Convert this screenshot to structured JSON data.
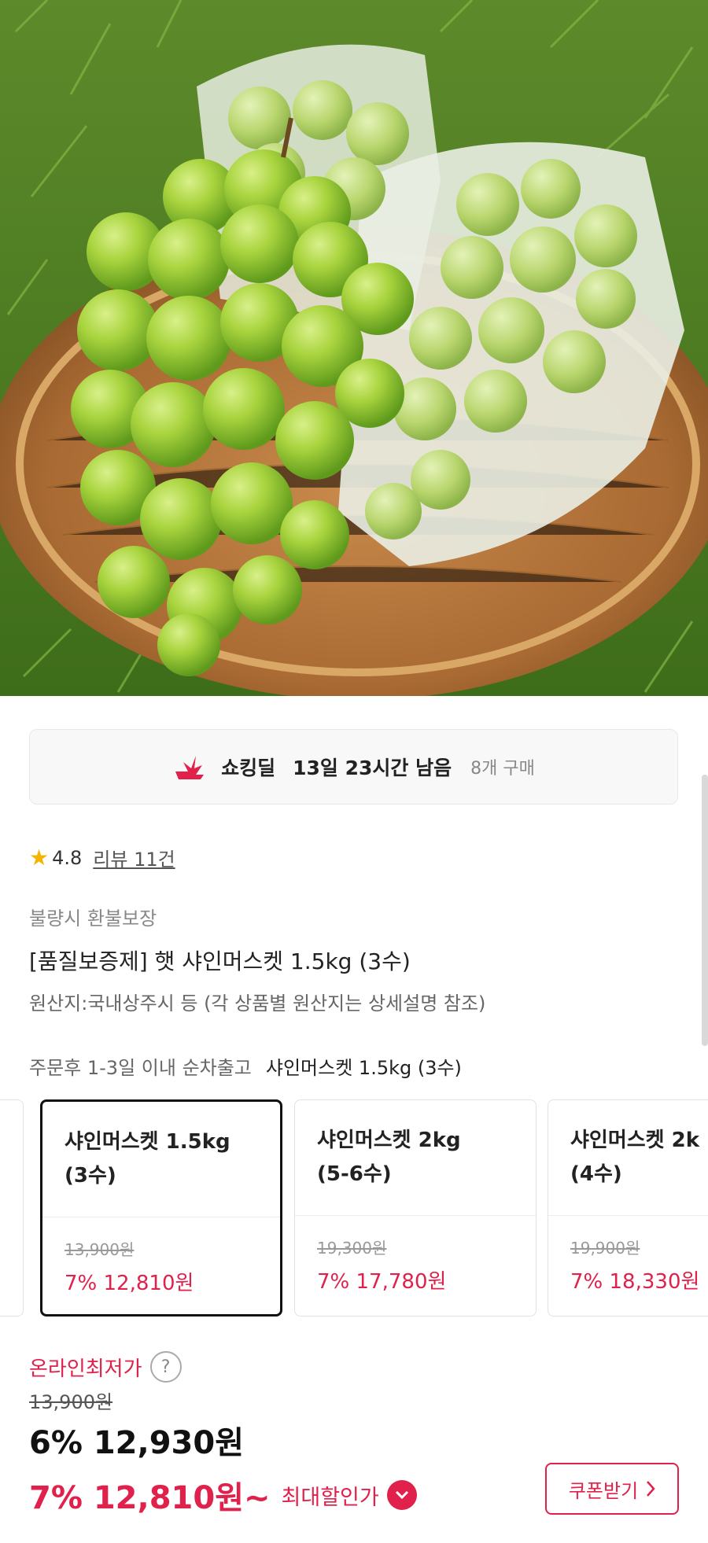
{
  "hero": {
    "image_name": "shine-muscat-grapes-in-basket"
  },
  "deal": {
    "name": "쇼킹딜",
    "time_left": "13일 23시간 남음",
    "purchase_count": "8개 구매",
    "logo_color": "#e0214b"
  },
  "rating": {
    "score": "4.8",
    "reviews": "리뷰 11건"
  },
  "refund": "불량시 환불보장",
  "product_title": "[품질보증제] 햇 샤인머스켓 1.5kg (3수)",
  "origin": "원산지:국내상주시 등 (각 상품별 원산지는 상세설명 참조)",
  "shipping": {
    "text": "주문후 1-3일 이내 순차출고",
    "selected_option": "샤인머스켓 1.5kg (3수)"
  },
  "options": [
    {
      "name_line1": "샤인머스켓 1.5kg",
      "name_line2": "(3수)",
      "original": "13,900원",
      "price": "7% 12,810원",
      "selected": true
    },
    {
      "name_line1": "샤인머스켓 2kg",
      "name_line2": "(5-6수)",
      "original": "19,300원",
      "price": "7% 17,780원",
      "selected": false
    },
    {
      "name_line1": "샤인머스켓 2k",
      "name_line2": "(4수)",
      "original": "19,900원",
      "price": "7% 18,330원",
      "selected": false
    }
  ],
  "pricing": {
    "lowest_label": "온라인최저가",
    "help": "?",
    "original": "13,900원",
    "discount_price": "6% 12,930원",
    "best_price": "7% 12,810원~",
    "best_label": "최대할인가",
    "coupon": "쿠폰받기",
    "accent_color": "#e0214b"
  }
}
